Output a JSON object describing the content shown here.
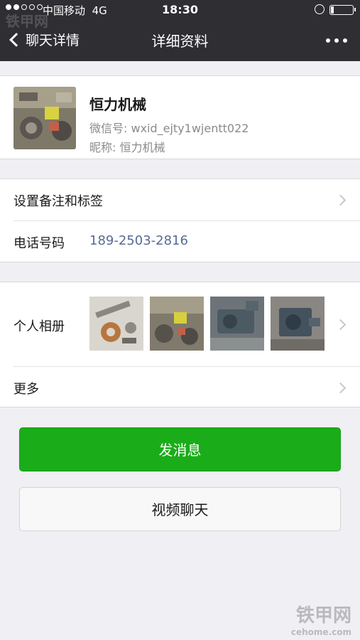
{
  "status_bar": {
    "carrier": "中国移动",
    "network": "4G",
    "time": "18:30"
  },
  "nav": {
    "back_label": "聊天详情",
    "title": "详细资料"
  },
  "profile": {
    "name": "恒力机械",
    "wechat_id": "微信号: wxid_ejty1wjentt022",
    "nickname": "昵称: 恒力机械"
  },
  "rows": {
    "remark_label": "设置备注和标签",
    "phone_label": "电话号码",
    "phone_value": "189-2503-2816",
    "album_label": "个人相册",
    "more_label": "更多"
  },
  "buttons": {
    "message": "发消息",
    "video": "视频聊天"
  },
  "watermark": {
    "brand": "铁甲网",
    "site": "cehome.com"
  },
  "colors": {
    "topbar": "#2e2e33",
    "primary_green": "#1aad19",
    "link_blue": "#576b95",
    "background": "#efeff4"
  }
}
